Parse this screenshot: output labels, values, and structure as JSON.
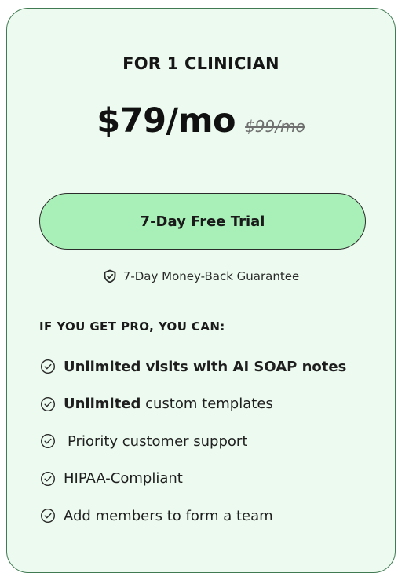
{
  "plan": {
    "title": "FOR 1 CLINICIAN",
    "price": "$79/mo",
    "original_price": "$99/mo"
  },
  "cta": {
    "label": "7-Day Free Trial"
  },
  "guarantee": {
    "icon": "shield-check-icon",
    "text": "7-Day Money-Back Guarantee"
  },
  "features": {
    "heading": "IF YOU GET PRO, YOU CAN:",
    "icon": "check-circle-icon",
    "items": [
      {
        "bold": "Unlimited visits with AI SOAP notes",
        "rest": ""
      },
      {
        "bold": "Unlimited",
        "rest": " custom templates"
      },
      {
        "bold": "",
        "rest": "Priority customer support"
      },
      {
        "bold": "",
        "rest": "HIPAA-Compliant"
      },
      {
        "bold": "",
        "rest": "Add members to form a team"
      }
    ]
  },
  "colors": {
    "card_background": "#ecfaef",
    "card_border": "#3f7a52",
    "button_background": "#a9f0b8",
    "text": "#1c1c1c"
  }
}
